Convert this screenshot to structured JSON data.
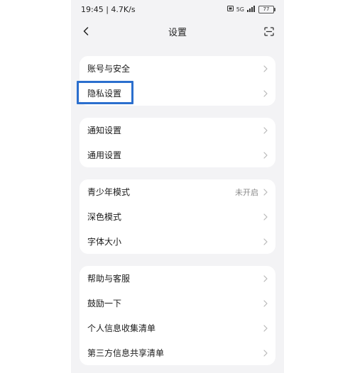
{
  "status_bar": {
    "time_speed": "19:45 | 4.7K/s",
    "network": "5G",
    "battery": "77"
  },
  "header": {
    "title": "设置"
  },
  "groups": [
    {
      "items": [
        {
          "label": "账号与安全"
        },
        {
          "label": "隐私设置"
        }
      ]
    },
    {
      "items": [
        {
          "label": "通知设置"
        },
        {
          "label": "通用设置"
        }
      ]
    },
    {
      "items": [
        {
          "label": "青少年模式",
          "value": "未开启"
        },
        {
          "label": "深色模式"
        },
        {
          "label": "字体大小"
        }
      ]
    },
    {
      "items": [
        {
          "label": "帮助与客服"
        },
        {
          "label": "鼓励一下"
        },
        {
          "label": "个人信息收集清单"
        },
        {
          "label": "第三方信息共享清单"
        }
      ]
    }
  ],
  "highlight_color": "#2b6fce"
}
